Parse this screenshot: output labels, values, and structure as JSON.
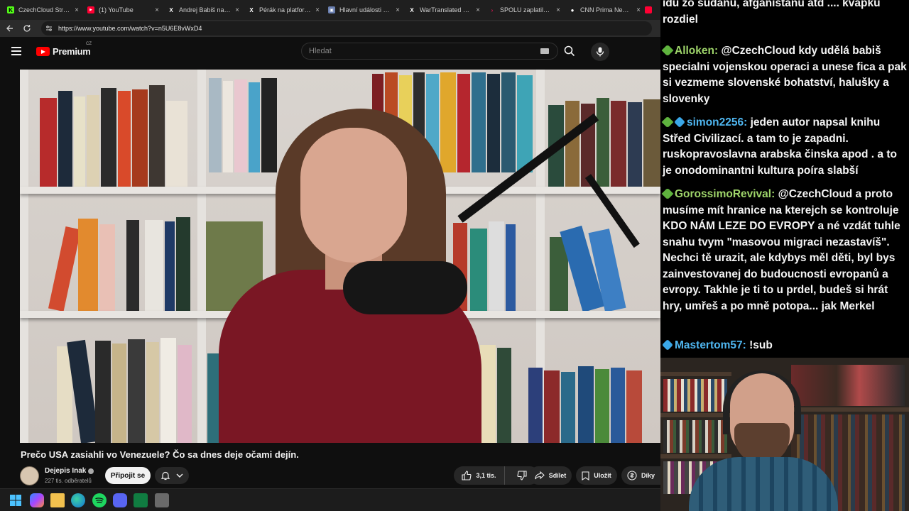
{
  "browser": {
    "tabs": [
      {
        "label": "CzechCloud Stream - ",
        "color": "#53fc18",
        "glyph": "K"
      },
      {
        "label": "(1) YouTube",
        "color": "#ff0033",
        "glyph": "▶"
      },
      {
        "label": "Andrej Babiš na platf",
        "color": "#000000",
        "glyph": "X"
      },
      {
        "label": "Pérák na platformě X:",
        "color": "#000000",
        "glyph": "X"
      },
      {
        "label": "Hlavní události — ČT",
        "color": "#6a7fb0",
        "glyph": "▣"
      },
      {
        "label": "WarTranslated na pla",
        "color": "#000000",
        "glyph": "X"
      },
      {
        "label": "SPOLU zaplatila statis",
        "color": "#d0164e",
        "glyph": "›"
      },
      {
        "label": "CNN Prima News HD",
        "color": "#ffffff",
        "glyph": "●"
      }
    ],
    "tab_close": "×",
    "url": "https://www.youtube.com/watch?v=n5U6E8vWxD4"
  },
  "youtube": {
    "logo_text": "Premium",
    "country": "CZ",
    "search_placeholder": "Hledat"
  },
  "video": {
    "title": "Prečo USA zasiahli vo Venezuele? Čo sa dnes deje očami dejín.",
    "channel": "Dejepis Inak",
    "subscribers": "227 tis. odběratelů",
    "join_label": "Připojit se",
    "likes": "3,1 tis.",
    "share_label": "Sdílet",
    "save_label": "Uložit",
    "thanks_label": "Díky"
  },
  "chat": {
    "messages": [
      {
        "user": "",
        "text": "idu zo sudanu, afganistanu atd .... kvapku rozdiel",
        "badges": []
      },
      {
        "user": "Alloken",
        "text": "@CzechCloud kdy udělá babiš specialni vojenskou operaci a unese fica a pak si vezmeme slovenské bohatství, halušky a slovenky",
        "badges": [
          "green"
        ],
        "color": "green"
      },
      {
        "user": "simon2256",
        "text": "jeden autor napsal knihu Střed Civilizací. a tam to je zapadni. ruskopravoslavna arabska činska apod . a to je onodominantni kultura poíra slabší",
        "badges": [
          "green",
          "blue"
        ],
        "color": "blue"
      },
      {
        "user": "GorossimoRevival",
        "text": "@CzechCloud a proto musíme mít hranice na kterejch se kontroluje KDO NÁM LEZE DO EVROPY a né vzdát tuhle snahu tvym \"masovou migraci nezastavíš\". Nechci tě urazit, ale kdybys měl děti, byl bys zainvestovanej do budoucnosti evropanů a evropy. Takhle je ti to u prdel, budeš si hrát hry, umřeš a po mně potopa... jak Merkel",
        "badges": [
          "green"
        ],
        "color": "green"
      },
      {
        "user": "Mastertom57",
        "text": "!sub",
        "badges": [
          "blue"
        ],
        "color": "blue"
      }
    ]
  },
  "taskbar": {
    "apps": [
      "windows-start-icon",
      "copilot-icon",
      "file-explorer-icon",
      "edge-icon",
      "spotify-icon",
      "discord-icon",
      "excel-icon",
      "calculator-icon"
    ]
  }
}
